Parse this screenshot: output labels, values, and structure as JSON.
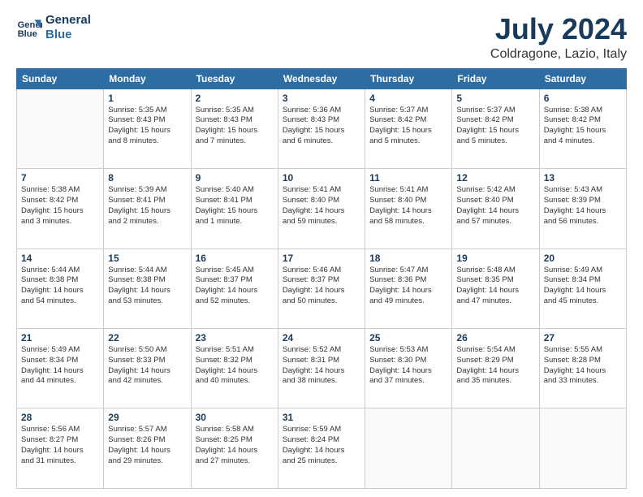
{
  "header": {
    "logo_line1": "General",
    "logo_line2": "Blue",
    "main_title": "July 2024",
    "subtitle": "Coldragone, Lazio, Italy"
  },
  "days_of_week": [
    "Sunday",
    "Monday",
    "Tuesday",
    "Wednesday",
    "Thursday",
    "Friday",
    "Saturday"
  ],
  "weeks": [
    [
      {
        "day": "",
        "info": ""
      },
      {
        "day": "1",
        "info": "Sunrise: 5:35 AM\nSunset: 8:43 PM\nDaylight: 15 hours\nand 8 minutes."
      },
      {
        "day": "2",
        "info": "Sunrise: 5:35 AM\nSunset: 8:43 PM\nDaylight: 15 hours\nand 7 minutes."
      },
      {
        "day": "3",
        "info": "Sunrise: 5:36 AM\nSunset: 8:43 PM\nDaylight: 15 hours\nand 6 minutes."
      },
      {
        "day": "4",
        "info": "Sunrise: 5:37 AM\nSunset: 8:42 PM\nDaylight: 15 hours\nand 5 minutes."
      },
      {
        "day": "5",
        "info": "Sunrise: 5:37 AM\nSunset: 8:42 PM\nDaylight: 15 hours\nand 5 minutes."
      },
      {
        "day": "6",
        "info": "Sunrise: 5:38 AM\nSunset: 8:42 PM\nDaylight: 15 hours\nand 4 minutes."
      }
    ],
    [
      {
        "day": "7",
        "info": "Sunrise: 5:38 AM\nSunset: 8:42 PM\nDaylight: 15 hours\nand 3 minutes."
      },
      {
        "day": "8",
        "info": "Sunrise: 5:39 AM\nSunset: 8:41 PM\nDaylight: 15 hours\nand 2 minutes."
      },
      {
        "day": "9",
        "info": "Sunrise: 5:40 AM\nSunset: 8:41 PM\nDaylight: 15 hours\nand 1 minute."
      },
      {
        "day": "10",
        "info": "Sunrise: 5:41 AM\nSunset: 8:40 PM\nDaylight: 14 hours\nand 59 minutes."
      },
      {
        "day": "11",
        "info": "Sunrise: 5:41 AM\nSunset: 8:40 PM\nDaylight: 14 hours\nand 58 minutes."
      },
      {
        "day": "12",
        "info": "Sunrise: 5:42 AM\nSunset: 8:40 PM\nDaylight: 14 hours\nand 57 minutes."
      },
      {
        "day": "13",
        "info": "Sunrise: 5:43 AM\nSunset: 8:39 PM\nDaylight: 14 hours\nand 56 minutes."
      }
    ],
    [
      {
        "day": "14",
        "info": "Sunrise: 5:44 AM\nSunset: 8:38 PM\nDaylight: 14 hours\nand 54 minutes."
      },
      {
        "day": "15",
        "info": "Sunrise: 5:44 AM\nSunset: 8:38 PM\nDaylight: 14 hours\nand 53 minutes."
      },
      {
        "day": "16",
        "info": "Sunrise: 5:45 AM\nSunset: 8:37 PM\nDaylight: 14 hours\nand 52 minutes."
      },
      {
        "day": "17",
        "info": "Sunrise: 5:46 AM\nSunset: 8:37 PM\nDaylight: 14 hours\nand 50 minutes."
      },
      {
        "day": "18",
        "info": "Sunrise: 5:47 AM\nSunset: 8:36 PM\nDaylight: 14 hours\nand 49 minutes."
      },
      {
        "day": "19",
        "info": "Sunrise: 5:48 AM\nSunset: 8:35 PM\nDaylight: 14 hours\nand 47 minutes."
      },
      {
        "day": "20",
        "info": "Sunrise: 5:49 AM\nSunset: 8:34 PM\nDaylight: 14 hours\nand 45 minutes."
      }
    ],
    [
      {
        "day": "21",
        "info": "Sunrise: 5:49 AM\nSunset: 8:34 PM\nDaylight: 14 hours\nand 44 minutes."
      },
      {
        "day": "22",
        "info": "Sunrise: 5:50 AM\nSunset: 8:33 PM\nDaylight: 14 hours\nand 42 minutes."
      },
      {
        "day": "23",
        "info": "Sunrise: 5:51 AM\nSunset: 8:32 PM\nDaylight: 14 hours\nand 40 minutes."
      },
      {
        "day": "24",
        "info": "Sunrise: 5:52 AM\nSunset: 8:31 PM\nDaylight: 14 hours\nand 38 minutes."
      },
      {
        "day": "25",
        "info": "Sunrise: 5:53 AM\nSunset: 8:30 PM\nDaylight: 14 hours\nand 37 minutes."
      },
      {
        "day": "26",
        "info": "Sunrise: 5:54 AM\nSunset: 8:29 PM\nDaylight: 14 hours\nand 35 minutes."
      },
      {
        "day": "27",
        "info": "Sunrise: 5:55 AM\nSunset: 8:28 PM\nDaylight: 14 hours\nand 33 minutes."
      }
    ],
    [
      {
        "day": "28",
        "info": "Sunrise: 5:56 AM\nSunset: 8:27 PM\nDaylight: 14 hours\nand 31 minutes."
      },
      {
        "day": "29",
        "info": "Sunrise: 5:57 AM\nSunset: 8:26 PM\nDaylight: 14 hours\nand 29 minutes."
      },
      {
        "day": "30",
        "info": "Sunrise: 5:58 AM\nSunset: 8:25 PM\nDaylight: 14 hours\nand 27 minutes."
      },
      {
        "day": "31",
        "info": "Sunrise: 5:59 AM\nSunset: 8:24 PM\nDaylight: 14 hours\nand 25 minutes."
      },
      {
        "day": "",
        "info": ""
      },
      {
        "day": "",
        "info": ""
      },
      {
        "day": "",
        "info": ""
      }
    ]
  ]
}
